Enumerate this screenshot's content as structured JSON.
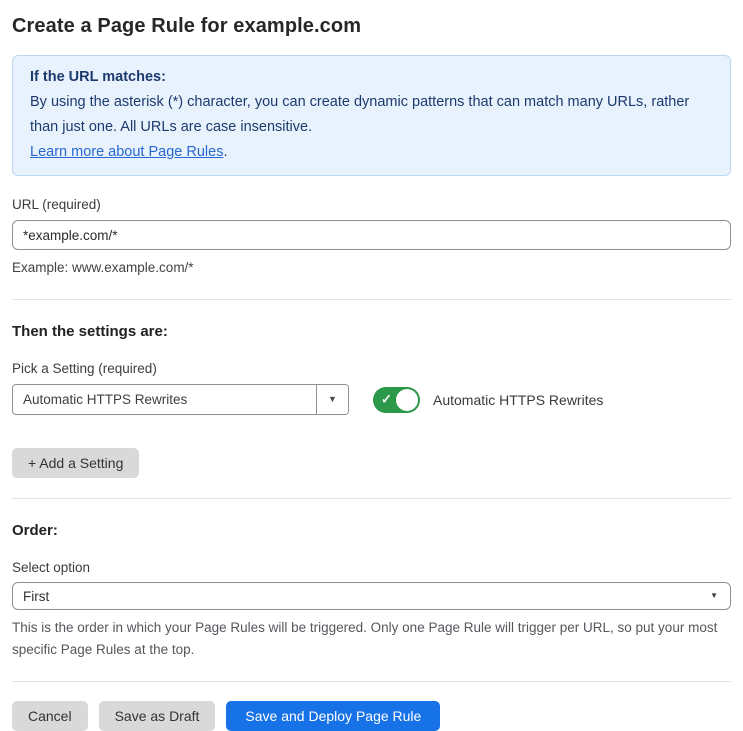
{
  "page": {
    "title": "Create a Page Rule for example.com"
  },
  "info_box": {
    "heading": "If the URL matches:",
    "body": "By using the asterisk (*) character, you can create dynamic patterns that can match many URLs, rather than just one. All URLs are case insensitive.",
    "link_text": "Learn more about Page Rules",
    "link_suffix": "."
  },
  "url_field": {
    "label": "URL (required)",
    "value": "*example.com/*",
    "helper": "Example: www.example.com/*"
  },
  "settings_section": {
    "heading": "Then the settings are:",
    "picker_label": "Pick a Setting (required)",
    "picker_value": "Automatic HTTPS Rewrites",
    "toggle_label": "Automatic HTTPS Rewrites",
    "toggle_state": "on",
    "add_setting_label": "+ Add a Setting"
  },
  "order_section": {
    "heading": "Order:",
    "select_label": "Select option",
    "select_value": "First",
    "helper": "This is the order in which your Page Rules will be triggered. Only one Page Rule will trigger per URL, so put your most specific Page Rules at the top."
  },
  "footer": {
    "cancel_label": "Cancel",
    "save_draft_label": "Save as Draft",
    "save_deploy_label": "Save and Deploy Page Rule"
  },
  "icons": {
    "dropdown_arrow": "▼",
    "toggle_check": "✓"
  },
  "colors": {
    "accent_blue": "#1672e6",
    "info_bg": "#e8f2fc",
    "info_border": "#bcd7f3",
    "info_text": "#1d3a6e",
    "link_blue": "#2767d2",
    "toggle_green": "#2b984a",
    "button_gray": "#d9d9d9"
  }
}
